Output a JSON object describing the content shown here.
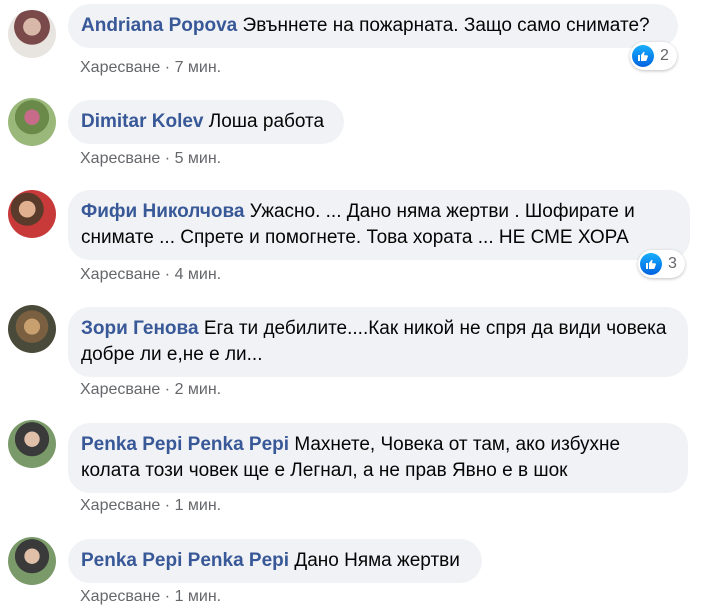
{
  "comments": [
    {
      "author": "Andriana Popova",
      "text": "Эвъннете на пожарната. Защо само снимате?",
      "like_label": "Харесване",
      "separator": "·",
      "time": "7 мин.",
      "reactions": "2"
    },
    {
      "author": "Dimitar Kolev",
      "text": "Лоша работа",
      "like_label": "Харесване",
      "separator": "·",
      "time": "5 мин."
    },
    {
      "author": "Фифи Николчова",
      "text": "Ужасно. ... Дано няма жертви . Шофирате и снимате ... Спрете и помогнете. Това хората ... НЕ СМЕ ХОРА",
      "like_label": "Харесване",
      "separator": "·",
      "time": "4 мин.",
      "reactions": "3"
    },
    {
      "author": "Зори Генова",
      "text": "Ега ти дебилите....Как никой не спря да види човека добре ли е,не е ли...",
      "like_label": "Харесване",
      "separator": "·",
      "time": "2 мин."
    },
    {
      "author": "Penka Pepi Penka Pepi",
      "text": "Махнете, Човека от там, ако избухне колата този човек ще е Легнал, а не прав Явно е в шок",
      "like_label": "Харесване",
      "separator": "·",
      "time": "1 мин."
    },
    {
      "author": "Penka Pepi Penka Pepi",
      "text": "Дано Няма жертви",
      "like_label": "Харесване",
      "separator": "·",
      "time": "1 мин."
    }
  ],
  "colors": {
    "author": "#385898",
    "bubble": "#f0f2f5",
    "meta": "#65676b",
    "like_badge": "#1877f2"
  },
  "icons": {
    "reaction": "thumbs-up-icon"
  }
}
